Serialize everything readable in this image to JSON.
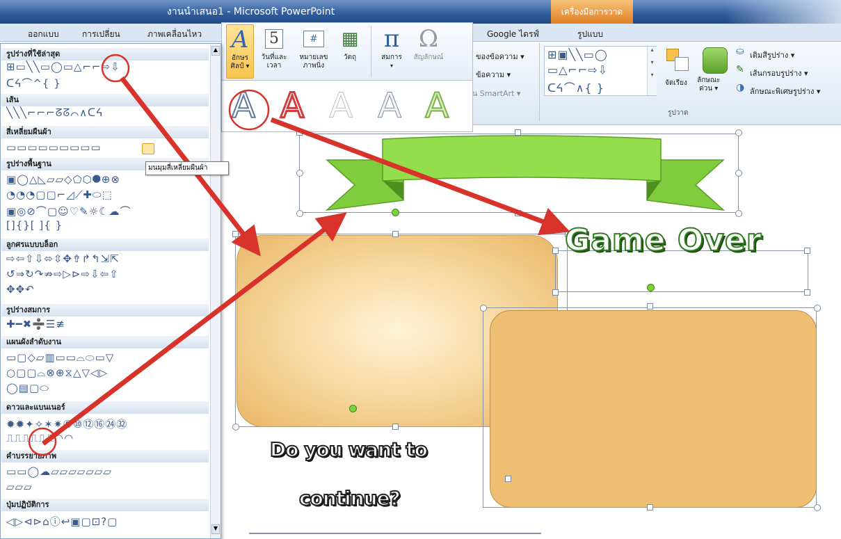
{
  "window": {
    "title": "งานนำเสนอ1 - Microsoft PowerPoint",
    "context_tab_group": "เครื่องมือการวาด"
  },
  "tabs": {
    "design": "ออกแบบ",
    "transitions": "การเปลี่ยน",
    "animations": "ภาพเคลื่อนไหว",
    "google_drive": "Google ไดรฟ์",
    "format": "รูปแบบ"
  },
  "insert_group": {
    "wordart": "อักษร\nศิลป์ ▾",
    "datetime": "วันที่และ\nเวลา",
    "slide_number": "หมายเลข\nภาพนิ่ง",
    "object": "วัตถุ",
    "equation": "สมการ",
    "symbol": "สัญลักษณ์",
    "date_icon_digit": "5",
    "slide_num_icon": "#"
  },
  "text_group": {
    "item1": "ของข้อความ ▾",
    "item2": "ข้อความ ▾",
    "item3": "เป็น SmartArt ▾"
  },
  "drawing_group": {
    "arrange": "จัดเรียง",
    "quick_styles": "ลักษณะ\nด่วน ▾",
    "shape_fill": "เติมสีรูปร่าง ▾",
    "shape_outline": "เส้นกรอบรูปร่าง ▾",
    "shape_effects": "ลักษณะพิเศษรูปร่าง ▾",
    "group_label": "รูปวาด"
  },
  "shape_panel": {
    "sections": [
      {
        "label": "รูปร่างที่ใช้ล่าสุด",
        "rows": [
          "⊞▭╲╲▭◯▭△⌐⌐⇨⇩",
          "ᑕᔦ⌒^{  }"
        ]
      },
      {
        "label": "เส้น",
        "rows": [
          "╲╲╲⌐⌐⌐ᘔᘔ⌒∧ᑕᔦ"
        ]
      },
      {
        "label": "สี่เหลี่ยมผืนผ้า",
        "rows": [
          "▭▭▭▭▭▭▭▭▭"
        ]
      },
      {
        "label": "รูปร่างพื้นฐาน",
        "rows": [
          "▣◯△◺▱▱◇⬠⬡⯃⊕⊗",
          "◔◔◔▢▢⌐◿⟋✚⬭⬚",
          "▣◎⊘⌒▢☺♡✎☼☾☁⌒",
          "[]{}[  ]{  }"
        ]
      },
      {
        "label": "ลูกศรแบบบล็อก",
        "rows": [
          "⇨⇦⇧⇩⬄⇳✥⇮↱↰⇲⇱",
          "↺⇒↻↷⇏⇨▷⊳⇨⇩⇦⇧",
          "✥✥↶"
        ]
      },
      {
        "label": "รูปร่างสมการ",
        "rows": [
          "✚━✖➗☰≢"
        ]
      },
      {
        "label": "แผนผังลำดับงาน",
        "rows": [
          "▭▢◇▱▥▭▭⌓⬭▭▽",
          "○▢▢⌓⊗⊕⧖△▽◁▷",
          "◯▤▢⬭"
        ]
      },
      {
        "label": "ดาวและแบนเนอร์",
        "rows": [
          "✹✹✦✧✶✷⑧⑩⑫⑯㉔㉜",
          "⎍⎍⎍⎍⎍⎍◠◠"
        ]
      },
      {
        "label": "คำบรรยายภาพ",
        "rows": [
          "▭▭◯☁▱▱▱▱▱▱▱",
          "▱▱▱"
        ]
      },
      {
        "label": "ปุ่มปฏิบัติการ",
        "rows": [
          "◁▷⊲⊳⌂ⓘ↩▣▢⊡?▢"
        ]
      }
    ],
    "tooltip": "มนมุมสี่เหลี่ยมผืนผ้า"
  },
  "wordart_gallery": {
    "styles": [
      "A",
      "A",
      "A",
      "A",
      "A"
    ]
  },
  "slide": {
    "title_text": "Game Over",
    "question_line1": "Do you want to",
    "question_line2": "continue?"
  },
  "colors": {
    "accent_red": "#d8332b",
    "ribbon_green": "#8dd64a",
    "shape_tan": "#f0c27a",
    "title_bar": "#2f5c9b",
    "context_orange": "#e98b2f"
  }
}
